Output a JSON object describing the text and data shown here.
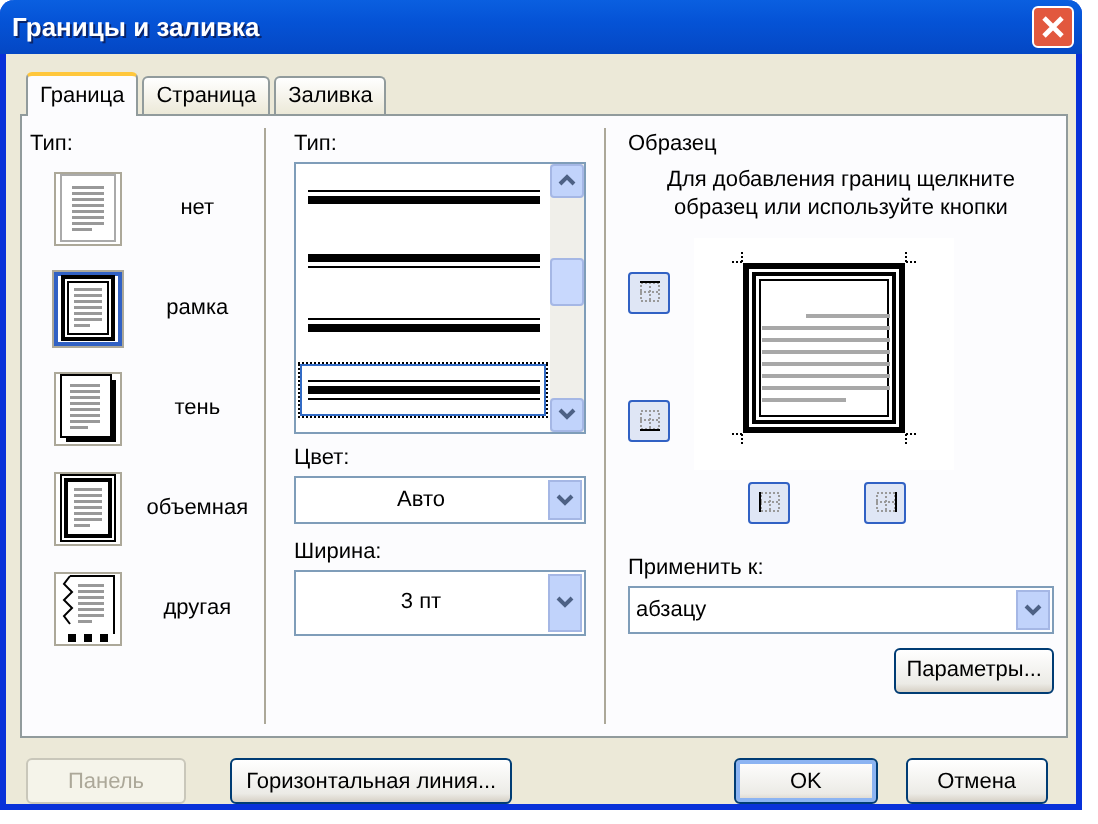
{
  "window": {
    "title": "Границы и заливка"
  },
  "tabs": [
    {
      "label": "Граница",
      "selected": true
    },
    {
      "label": "Страница",
      "selected": false
    },
    {
      "label": "Заливка",
      "selected": false
    }
  ],
  "setting": {
    "label": "Тип:",
    "options": [
      {
        "label": "нет",
        "kind": "none",
        "selected": false
      },
      {
        "label": "рамка",
        "kind": "box",
        "selected": true
      },
      {
        "label": "тень",
        "kind": "shadow",
        "selected": false
      },
      {
        "label": "объемная",
        "kind": "raised",
        "selected": false
      },
      {
        "label": "другая",
        "kind": "custom",
        "selected": false
      }
    ]
  },
  "style": {
    "label": "Тип:",
    "items": [
      {
        "kind": "thin-thick",
        "selected": false
      },
      {
        "kind": "thick-thin",
        "selected": false
      },
      {
        "kind": "thin-thick",
        "selected": false
      },
      {
        "kind": "thin-thick-thin",
        "selected": true
      }
    ]
  },
  "color": {
    "label": "Цвет:",
    "value": "Авто"
  },
  "width": {
    "label": "Ширина:",
    "value": "3 пт"
  },
  "preview": {
    "label": "Образец",
    "hint": "Для добавления границ щелкните образец или используйте кнопки",
    "buttons": [
      {
        "kind": "top",
        "pressed": true
      },
      {
        "kind": "bottom",
        "pressed": true
      },
      {
        "kind": "left",
        "pressed": true
      },
      {
        "kind": "right",
        "pressed": true
      }
    ]
  },
  "apply_to": {
    "label": "Применить к:",
    "value": "абзацу"
  },
  "options_button": "Параметры...",
  "footer": [
    {
      "label": "Панель",
      "disabled": true,
      "default": false
    },
    {
      "label": "Горизонтальная линия...",
      "disabled": false,
      "default": false
    },
    {
      "label": "OK",
      "disabled": false,
      "default": true
    },
    {
      "label": "Отмена",
      "disabled": false,
      "default": false
    }
  ]
}
